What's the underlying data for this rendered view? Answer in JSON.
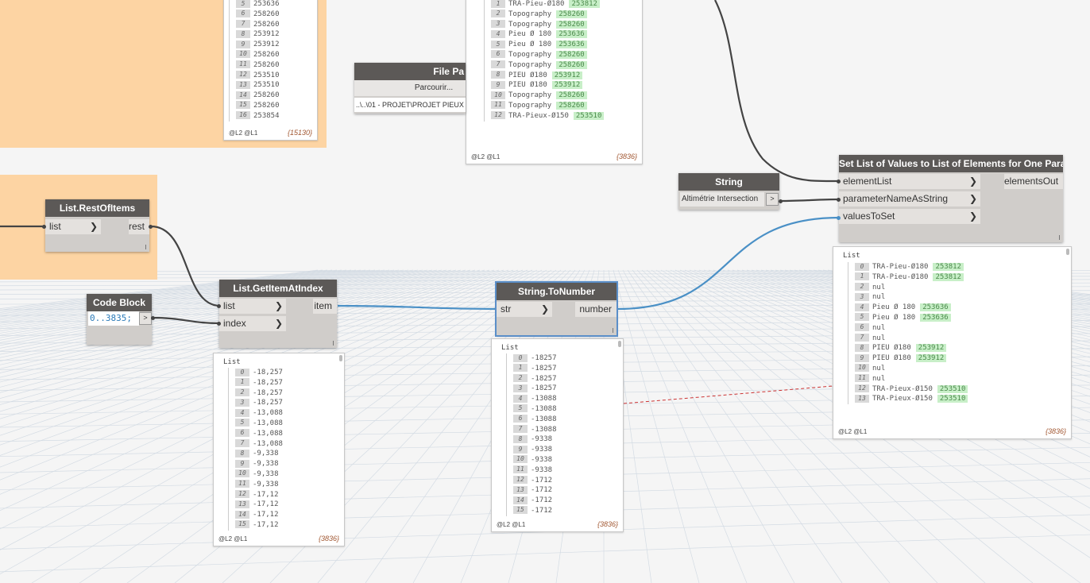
{
  "nodes": {
    "rest_of_items": {
      "title": "List.RestOfItems",
      "input": "list",
      "output": "rest"
    },
    "code_block": {
      "title": "Code Block",
      "code": "0..3835;",
      "out": ">"
    },
    "get_item": {
      "title": "List.GetItemAtIndex",
      "inputs": [
        "list",
        "index"
      ],
      "output": "item"
    },
    "to_number": {
      "title": "String.ToNumber",
      "input": "str",
      "output": "number"
    },
    "file_path": {
      "title": "File Pa",
      "button": "Parcourir...",
      "path": "..\\..\\01 - PROJET\\PROJET PIEUX"
    },
    "string_node": {
      "title": "String",
      "value": "Altimétrie Intersection",
      "out": ">"
    },
    "set_list": {
      "title": "Set List of Values to List of Elements for One Parameter",
      "inputs": [
        "elementList",
        "parameterNameAsString",
        "valuesToSet"
      ],
      "output": "elementsOut"
    }
  },
  "previews": {
    "top_left": {
      "rows": [
        {
          "i": "5",
          "v": "253636"
        },
        {
          "i": "6",
          "v": "258260"
        },
        {
          "i": "7",
          "v": "258260"
        },
        {
          "i": "8",
          "v": "253912"
        },
        {
          "i": "9",
          "v": "253912"
        },
        {
          "i": "10",
          "v": "258260"
        },
        {
          "i": "11",
          "v": "258260"
        },
        {
          "i": "12",
          "v": "253510"
        },
        {
          "i": "13",
          "v": "253510"
        },
        {
          "i": "14",
          "v": "258260"
        },
        {
          "i": "15",
          "v": "258260"
        },
        {
          "i": "16",
          "v": "253854"
        }
      ],
      "footer": "@L2 @L1",
      "count": "{15130}"
    },
    "top_mid": {
      "rows": [
        {
          "i": "1",
          "name": "TRA-Pieu-Ø180",
          "tag": "253812"
        },
        {
          "i": "2",
          "name": "Topography",
          "tag": "258260"
        },
        {
          "i": "3",
          "name": "Topography",
          "tag": "258260"
        },
        {
          "i": "4",
          "name": "Pieu Ø 180",
          "tag": "253636"
        },
        {
          "i": "5",
          "name": "Pieu Ø 180",
          "tag": "253636"
        },
        {
          "i": "6",
          "name": "Topography",
          "tag": "258260"
        },
        {
          "i": "7",
          "name": "Topography",
          "tag": "258260"
        },
        {
          "i": "8",
          "name": "PIEU Ø180",
          "tag": "253912"
        },
        {
          "i": "9",
          "name": "PIEU Ø180",
          "tag": "253912"
        },
        {
          "i": "10",
          "name": "Topography",
          "tag": "258260"
        },
        {
          "i": "11",
          "name": "Topography",
          "tag": "258260"
        },
        {
          "i": "12",
          "name": "TRA-Pieux-Ø150",
          "tag": "253510"
        }
      ],
      "footer": "@L2 @L1",
      "count": "{3836}"
    },
    "get_item": {
      "label": "List",
      "rows": [
        {
          "i": "0",
          "v": "-18,257"
        },
        {
          "i": "1",
          "v": "-18,257"
        },
        {
          "i": "2",
          "v": "-18,257"
        },
        {
          "i": "3",
          "v": "-18,257"
        },
        {
          "i": "4",
          "v": "-13,088"
        },
        {
          "i": "5",
          "v": "-13,088"
        },
        {
          "i": "6",
          "v": "-13,088"
        },
        {
          "i": "7",
          "v": "-13,088"
        },
        {
          "i": "8",
          "v": "-9,338"
        },
        {
          "i": "9",
          "v": "-9,338"
        },
        {
          "i": "10",
          "v": "-9,338"
        },
        {
          "i": "11",
          "v": "-9,338"
        },
        {
          "i": "12",
          "v": "-17,12"
        },
        {
          "i": "13",
          "v": "-17,12"
        },
        {
          "i": "14",
          "v": "-17,12"
        },
        {
          "i": "15",
          "v": "-17,12"
        }
      ],
      "footer": "@L2 @L1",
      "count": "{3836}"
    },
    "to_number": {
      "label": "List",
      "rows": [
        {
          "i": "0",
          "v": "-18257"
        },
        {
          "i": "1",
          "v": "-18257"
        },
        {
          "i": "2",
          "v": "-18257"
        },
        {
          "i": "3",
          "v": "-18257"
        },
        {
          "i": "4",
          "v": "-13088"
        },
        {
          "i": "5",
          "v": "-13088"
        },
        {
          "i": "6",
          "v": "-13088"
        },
        {
          "i": "7",
          "v": "-13088"
        },
        {
          "i": "8",
          "v": "-9338"
        },
        {
          "i": "9",
          "v": "-9338"
        },
        {
          "i": "10",
          "v": "-9338"
        },
        {
          "i": "11",
          "v": "-9338"
        },
        {
          "i": "12",
          "v": "-1712"
        },
        {
          "i": "13",
          "v": "-1712"
        },
        {
          "i": "14",
          "v": "-1712"
        },
        {
          "i": "15",
          "v": "-1712"
        }
      ],
      "footer": "@L2 @L1",
      "count": "{3836}"
    },
    "set_list": {
      "label": "List",
      "rows": [
        {
          "i": "0",
          "name": "TRA-Pieu-Ø180",
          "tag": "253812"
        },
        {
          "i": "1",
          "name": "TRA-Pieu-Ø180",
          "tag": "253812"
        },
        {
          "i": "2",
          "name": "nul",
          "tag": ""
        },
        {
          "i": "3",
          "name": "nul",
          "tag": ""
        },
        {
          "i": "4",
          "name": "Pieu Ø 180",
          "tag": "253636"
        },
        {
          "i": "5",
          "name": "Pieu Ø 180",
          "tag": "253636"
        },
        {
          "i": "6",
          "name": "nul",
          "tag": ""
        },
        {
          "i": "7",
          "name": "nul",
          "tag": ""
        },
        {
          "i": "8",
          "name": "PIEU Ø180",
          "tag": "253912"
        },
        {
          "i": "9",
          "name": "PIEU Ø180",
          "tag": "253912"
        },
        {
          "i": "10",
          "name": "nul",
          "tag": ""
        },
        {
          "i": "11",
          "name": "nul",
          "tag": ""
        },
        {
          "i": "12",
          "name": "TRA-Pieux-Ø150",
          "tag": "253510"
        },
        {
          "i": "13",
          "name": "TRA-Pieux-Ø150",
          "tag": "253510"
        }
      ],
      "footer": "@L2 @L1",
      "count": "{3836}"
    }
  },
  "colors": {
    "group": "#fdd4a3",
    "node_title": "#5c5957",
    "wire_dark": "#444444",
    "wire_blue": "#4a90c6",
    "tag_bg": "#c8efc8",
    "tag_text": "#4b8a4b"
  }
}
